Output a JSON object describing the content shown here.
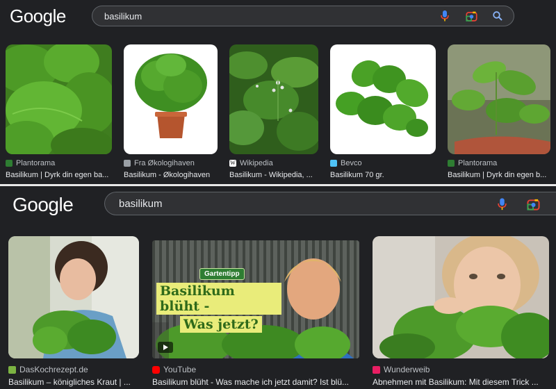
{
  "top": {
    "logo": "Google",
    "search": {
      "value": "basilikum"
    },
    "results": [
      {
        "source": "Plantorama",
        "caption": "Basilikum | Dyrk din egen ba..."
      },
      {
        "source": "Fra Økologihaven",
        "caption": "Basilikum - Økologihaven"
      },
      {
        "source": "Wikipedia",
        "caption": "Basilikum - Wikipedia, ..."
      },
      {
        "source": "Bevco",
        "caption": "Basilikum 70 gr."
      },
      {
        "source": "Plantorama",
        "caption": "Basilikum | Dyrk din egen b..."
      }
    ]
  },
  "bottom": {
    "logo": "Google",
    "search": {
      "value": "basilikum"
    },
    "results": [
      {
        "source": "DasKochrezept.de",
        "caption": "Basilikum – königliches Kraut | ..."
      },
      {
        "source": "YouTube",
        "caption": "Basilikum blüht - Was mache ich jetzt damit? Ist blü...",
        "overlay_badge": "Gartentipp",
        "overlay_line1": "Basilikum blüht -",
        "overlay_line2": "Was jetzt?"
      },
      {
        "source": "Wunderweib",
        "caption": "Abnehmen mit Basilikum: Mit diesem Trick ..."
      }
    ]
  },
  "colors": {
    "background": "#202124",
    "searchbox": "#303134",
    "text": "#e8eaed",
    "muted": "#bdc1c6",
    "mic_blue": "#4285f4",
    "mic_red": "#ea4335",
    "search_icon": "#8ab4f8",
    "favicon_plantorama": "#2e7d32",
    "favicon_youtube": "#ff0000",
    "favicon_daskochrezept": "#7cb342",
    "favicon_wunderweib": "#e91e63",
    "favicon_bevco": "#4fc3f7",
    "favicon_wikipedia": "#ffffff"
  }
}
